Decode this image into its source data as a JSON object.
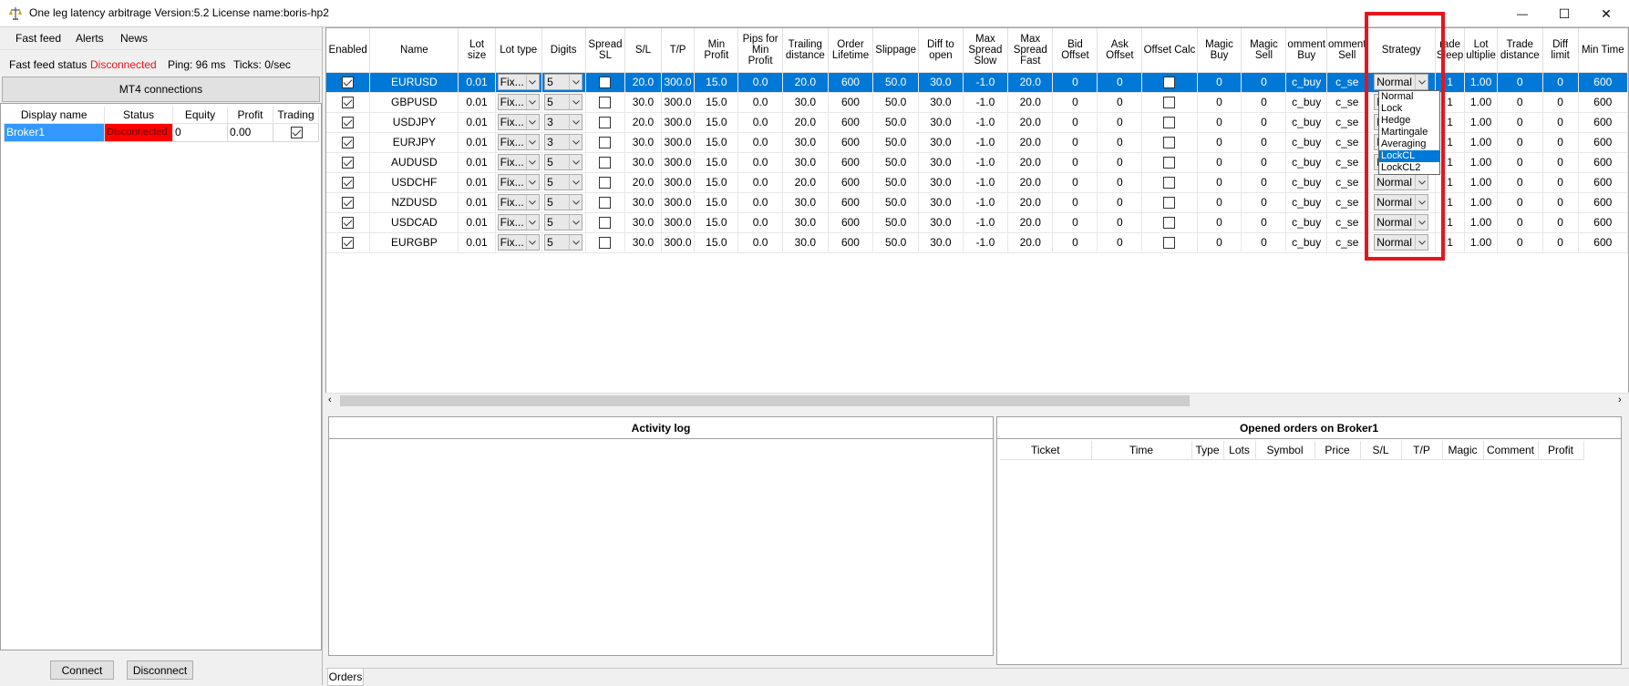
{
  "window": {
    "title": "One leg latency arbitrage Version:5.2 License name:boris-hp2",
    "minimize_glyph": "—",
    "maximize_glyph": "☐",
    "close_glyph": "✕"
  },
  "menu": [
    "Fast feed",
    "Alerts",
    "News"
  ],
  "status": {
    "fast_feed_label": "Fast feed status",
    "fast_feed_value": "Disconnected",
    "ping": "Ping: 96 ms",
    "ticks": "Ticks: 0/sec"
  },
  "mt4_button": "MT4 connections",
  "brokers": {
    "headers": [
      "Display name",
      "Status",
      "Equity",
      "Profit",
      "Trading"
    ],
    "rows": [
      {
        "name": "Broker1",
        "status": "Disconnected",
        "equity": "0",
        "profit": "0.00",
        "trading": true
      }
    ]
  },
  "buttons": {
    "connect": "Connect",
    "disconnect": "Disconnect"
  },
  "symbols_grid": {
    "headers": [
      "Enabled",
      "Name",
      "Lot size",
      "Lot type",
      "Digits",
      "Spread SL",
      "S/L",
      "T/P",
      "Min Profit",
      "Pips for Min Profit",
      "Trailing distance",
      "Order Lifetime",
      "Slippage",
      "Diff to open",
      "Max Spread Slow",
      "Max Spread Fast",
      "Bid Offset",
      "Ask Offset",
      "Offset Calc",
      "Magic Buy",
      "Magic Sell",
      "omment Buy",
      "omment Sell",
      "Strategy",
      "rade Sleep",
      "Lot ultiplie",
      "Trade distance",
      "Diff limit",
      "Min Time"
    ],
    "rows": [
      {
        "enabled": true,
        "name": "EURUSD",
        "lot": "0.01",
        "lot_type": "Fix...",
        "digits": "5",
        "spread_sl": false,
        "sl": "20.0",
        "tp": "300.0",
        "min_profit": "15.0",
        "pips_min": "0.0",
        "trail": "20.0",
        "lifetime": "600",
        "slippage": "50.0",
        "diff_open": "30.0",
        "max_slow": "-1.0",
        "max_fast": "20.0",
        "bid_off": "0",
        "ask_off": "0",
        "offset_calc": false,
        "magic_buy": "0",
        "magic_sell": "0",
        "comment_buy": "c_buy",
        "comment_sell": "c_se",
        "strategy": "Normal",
        "trade_sleep": "1",
        "lot_mult": "1.00",
        "trade_dist": "0",
        "diff_limit": "0",
        "min_time": "600"
      },
      {
        "enabled": true,
        "name": "GBPUSD",
        "lot": "0.01",
        "lot_type": "Fix...",
        "digits": "5",
        "spread_sl": false,
        "sl": "30.0",
        "tp": "300.0",
        "min_profit": "15.0",
        "pips_min": "0.0",
        "trail": "30.0",
        "lifetime": "600",
        "slippage": "50.0",
        "diff_open": "30.0",
        "max_slow": "-1.0",
        "max_fast": "20.0",
        "bid_off": "0",
        "ask_off": "0",
        "offset_calc": false,
        "magic_buy": "0",
        "magic_sell": "0",
        "comment_buy": "c_buy",
        "comment_sell": "c_se",
        "strategy": "Normal",
        "trade_sleep": "1",
        "lot_mult": "1.00",
        "trade_dist": "0",
        "diff_limit": "0",
        "min_time": "600"
      },
      {
        "enabled": true,
        "name": "USDJPY",
        "lot": "0.01",
        "lot_type": "Fix...",
        "digits": "3",
        "spread_sl": false,
        "sl": "20.0",
        "tp": "300.0",
        "min_profit": "15.0",
        "pips_min": "0.0",
        "trail": "20.0",
        "lifetime": "600",
        "slippage": "50.0",
        "diff_open": "30.0",
        "max_slow": "-1.0",
        "max_fast": "20.0",
        "bid_off": "0",
        "ask_off": "0",
        "offset_calc": false,
        "magic_buy": "0",
        "magic_sell": "0",
        "comment_buy": "c_buy",
        "comment_sell": "c_se",
        "strategy": "Normal",
        "trade_sleep": "1",
        "lot_mult": "1.00",
        "trade_dist": "0",
        "diff_limit": "0",
        "min_time": "600"
      },
      {
        "enabled": true,
        "name": "EURJPY",
        "lot": "0.01",
        "lot_type": "Fix...",
        "digits": "3",
        "spread_sl": false,
        "sl": "30.0",
        "tp": "300.0",
        "min_profit": "15.0",
        "pips_min": "0.0",
        "trail": "30.0",
        "lifetime": "600",
        "slippage": "50.0",
        "diff_open": "30.0",
        "max_slow": "-1.0",
        "max_fast": "20.0",
        "bid_off": "0",
        "ask_off": "0",
        "offset_calc": false,
        "magic_buy": "0",
        "magic_sell": "0",
        "comment_buy": "c_buy",
        "comment_sell": "c_se",
        "strategy": "Normal",
        "trade_sleep": "1",
        "lot_mult": "1.00",
        "trade_dist": "0",
        "diff_limit": "0",
        "min_time": "600"
      },
      {
        "enabled": true,
        "name": "AUDUSD",
        "lot": "0.01",
        "lot_type": "Fix...",
        "digits": "5",
        "spread_sl": false,
        "sl": "30.0",
        "tp": "300.0",
        "min_profit": "15.0",
        "pips_min": "0.0",
        "trail": "30.0",
        "lifetime": "600",
        "slippage": "50.0",
        "diff_open": "30.0",
        "max_slow": "-1.0",
        "max_fast": "20.0",
        "bid_off": "0",
        "ask_off": "0",
        "offset_calc": false,
        "magic_buy": "0",
        "magic_sell": "0",
        "comment_buy": "c_buy",
        "comment_sell": "c_se",
        "strategy": "Normal",
        "trade_sleep": "1",
        "lot_mult": "1.00",
        "trade_dist": "0",
        "diff_limit": "0",
        "min_time": "600"
      },
      {
        "enabled": true,
        "name": "USDCHF",
        "lot": "0.01",
        "lot_type": "Fix...",
        "digits": "5",
        "spread_sl": false,
        "sl": "20.0",
        "tp": "300.0",
        "min_profit": "15.0",
        "pips_min": "0.0",
        "trail": "20.0",
        "lifetime": "600",
        "slippage": "50.0",
        "diff_open": "30.0",
        "max_slow": "-1.0",
        "max_fast": "20.0",
        "bid_off": "0",
        "ask_off": "0",
        "offset_calc": false,
        "magic_buy": "0",
        "magic_sell": "0",
        "comment_buy": "c_buy",
        "comment_sell": "c_se",
        "strategy": "Normal",
        "trade_sleep": "1",
        "lot_mult": "1.00",
        "trade_dist": "0",
        "diff_limit": "0",
        "min_time": "600"
      },
      {
        "enabled": true,
        "name": "NZDUSD",
        "lot": "0.01",
        "lot_type": "Fix...",
        "digits": "5",
        "spread_sl": false,
        "sl": "30.0",
        "tp": "300.0",
        "min_profit": "15.0",
        "pips_min": "0.0",
        "trail": "30.0",
        "lifetime": "600",
        "slippage": "50.0",
        "diff_open": "30.0",
        "max_slow": "-1.0",
        "max_fast": "20.0",
        "bid_off": "0",
        "ask_off": "0",
        "offset_calc": false,
        "magic_buy": "0",
        "magic_sell": "0",
        "comment_buy": "c_buy",
        "comment_sell": "c_se",
        "strategy": "Normal",
        "trade_sleep": "1",
        "lot_mult": "1.00",
        "trade_dist": "0",
        "diff_limit": "0",
        "min_time": "600"
      },
      {
        "enabled": true,
        "name": "USDCAD",
        "lot": "0.01",
        "lot_type": "Fix...",
        "digits": "5",
        "spread_sl": false,
        "sl": "30.0",
        "tp": "300.0",
        "min_profit": "15.0",
        "pips_min": "0.0",
        "trail": "30.0",
        "lifetime": "600",
        "slippage": "50.0",
        "diff_open": "30.0",
        "max_slow": "-1.0",
        "max_fast": "20.0",
        "bid_off": "0",
        "ask_off": "0",
        "offset_calc": false,
        "magic_buy": "0",
        "magic_sell": "0",
        "comment_buy": "c_buy",
        "comment_sell": "c_se",
        "strategy": "Normal",
        "trade_sleep": "1",
        "lot_mult": "1.00",
        "trade_dist": "0",
        "diff_limit": "0",
        "min_time": "600"
      },
      {
        "enabled": true,
        "name": "EURGBP",
        "lot": "0.01",
        "lot_type": "Fix...",
        "digits": "5",
        "spread_sl": false,
        "sl": "30.0",
        "tp": "300.0",
        "min_profit": "15.0",
        "pips_min": "0.0",
        "trail": "30.0",
        "lifetime": "600",
        "slippage": "50.0",
        "diff_open": "30.0",
        "max_slow": "-1.0",
        "max_fast": "20.0",
        "bid_off": "0",
        "ask_off": "0",
        "offset_calc": false,
        "magic_buy": "0",
        "magic_sell": "0",
        "comment_buy": "c_buy",
        "comment_sell": "c_se",
        "strategy": "Normal",
        "trade_sleep": "1",
        "lot_mult": "1.00",
        "trade_dist": "0",
        "diff_limit": "0",
        "min_time": "600"
      }
    ],
    "selected_row": 0
  },
  "strategy_dropdown": {
    "options": [
      "Normal",
      "Lock",
      "Hedge",
      "Martingale",
      "Averaging",
      "LockCL",
      "LockCL2"
    ],
    "highlighted": "LockCL"
  },
  "activity_log": {
    "title": "Activity log"
  },
  "orders_panel": {
    "title": "Opened orders on Broker1",
    "headers": [
      "Ticket",
      "Time",
      "Type",
      "Lots",
      "Symbol",
      "Price",
      "S/L",
      "T/P",
      "Magic",
      "Comment",
      "Profit"
    ]
  },
  "bottom_tabs": [
    "Orders"
  ],
  "colors": {
    "accent": "#0078d7",
    "disconnected_text": "#e8141c",
    "disconnected_bg": "#ff0000",
    "highlight_box": "#e8141c"
  },
  "icons": {
    "app": "scales-icon",
    "dropdown": "chevron-down-icon",
    "scroll_left": "scroll-left-icon",
    "scroll_right": "scroll-right-icon"
  }
}
